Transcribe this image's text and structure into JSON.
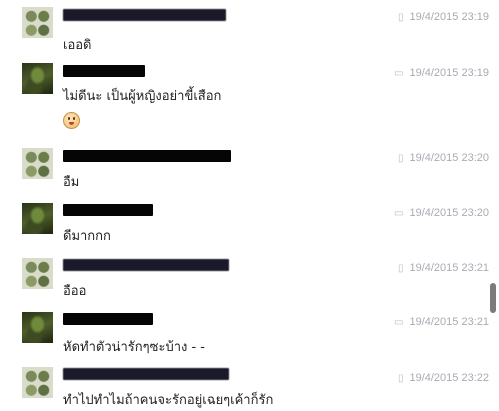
{
  "messages": [
    {
      "sender": "",
      "time": "19/4/2015 23:19",
      "device": "mobile-icon",
      "text": "เออดิ",
      "avatar": "avatar-sender-a"
    },
    {
      "sender": "",
      "time": "19/4/2015 23:19",
      "device": "chat-icon",
      "text": "ไม่ดีนะ เป็นผู้หญิงอย่าขี้เสือก",
      "emoji": "tongue-out-emoji-icon",
      "avatar": "avatar-sender-b"
    },
    {
      "sender": "",
      "time": "19/4/2015 23:20",
      "device": "mobile-icon",
      "text": "อืม",
      "avatar": "avatar-sender-a"
    },
    {
      "sender": "",
      "time": "19/4/2015 23:20",
      "device": "chat-icon",
      "text": "ดีมากกก",
      "avatar": "avatar-sender-b"
    },
    {
      "sender": "",
      "time": "19/4/2015 23:21",
      "device": "mobile-icon",
      "text": "อืออ",
      "avatar": "avatar-sender-a"
    },
    {
      "sender": "",
      "time": "19/4/2015 23:21",
      "device": "chat-icon",
      "text": "หัดทำตัวน่ารักๆซะบ้าง - -",
      "avatar": "avatar-sender-b"
    },
    {
      "sender": "",
      "time": "19/4/2015 23:22",
      "device": "mobile-icon",
      "text": "ทำไปทำไมถ้าคนจะรักอยู่เฉยๆเค้าก็รัก",
      "avatar": "avatar-sender-a"
    }
  ]
}
